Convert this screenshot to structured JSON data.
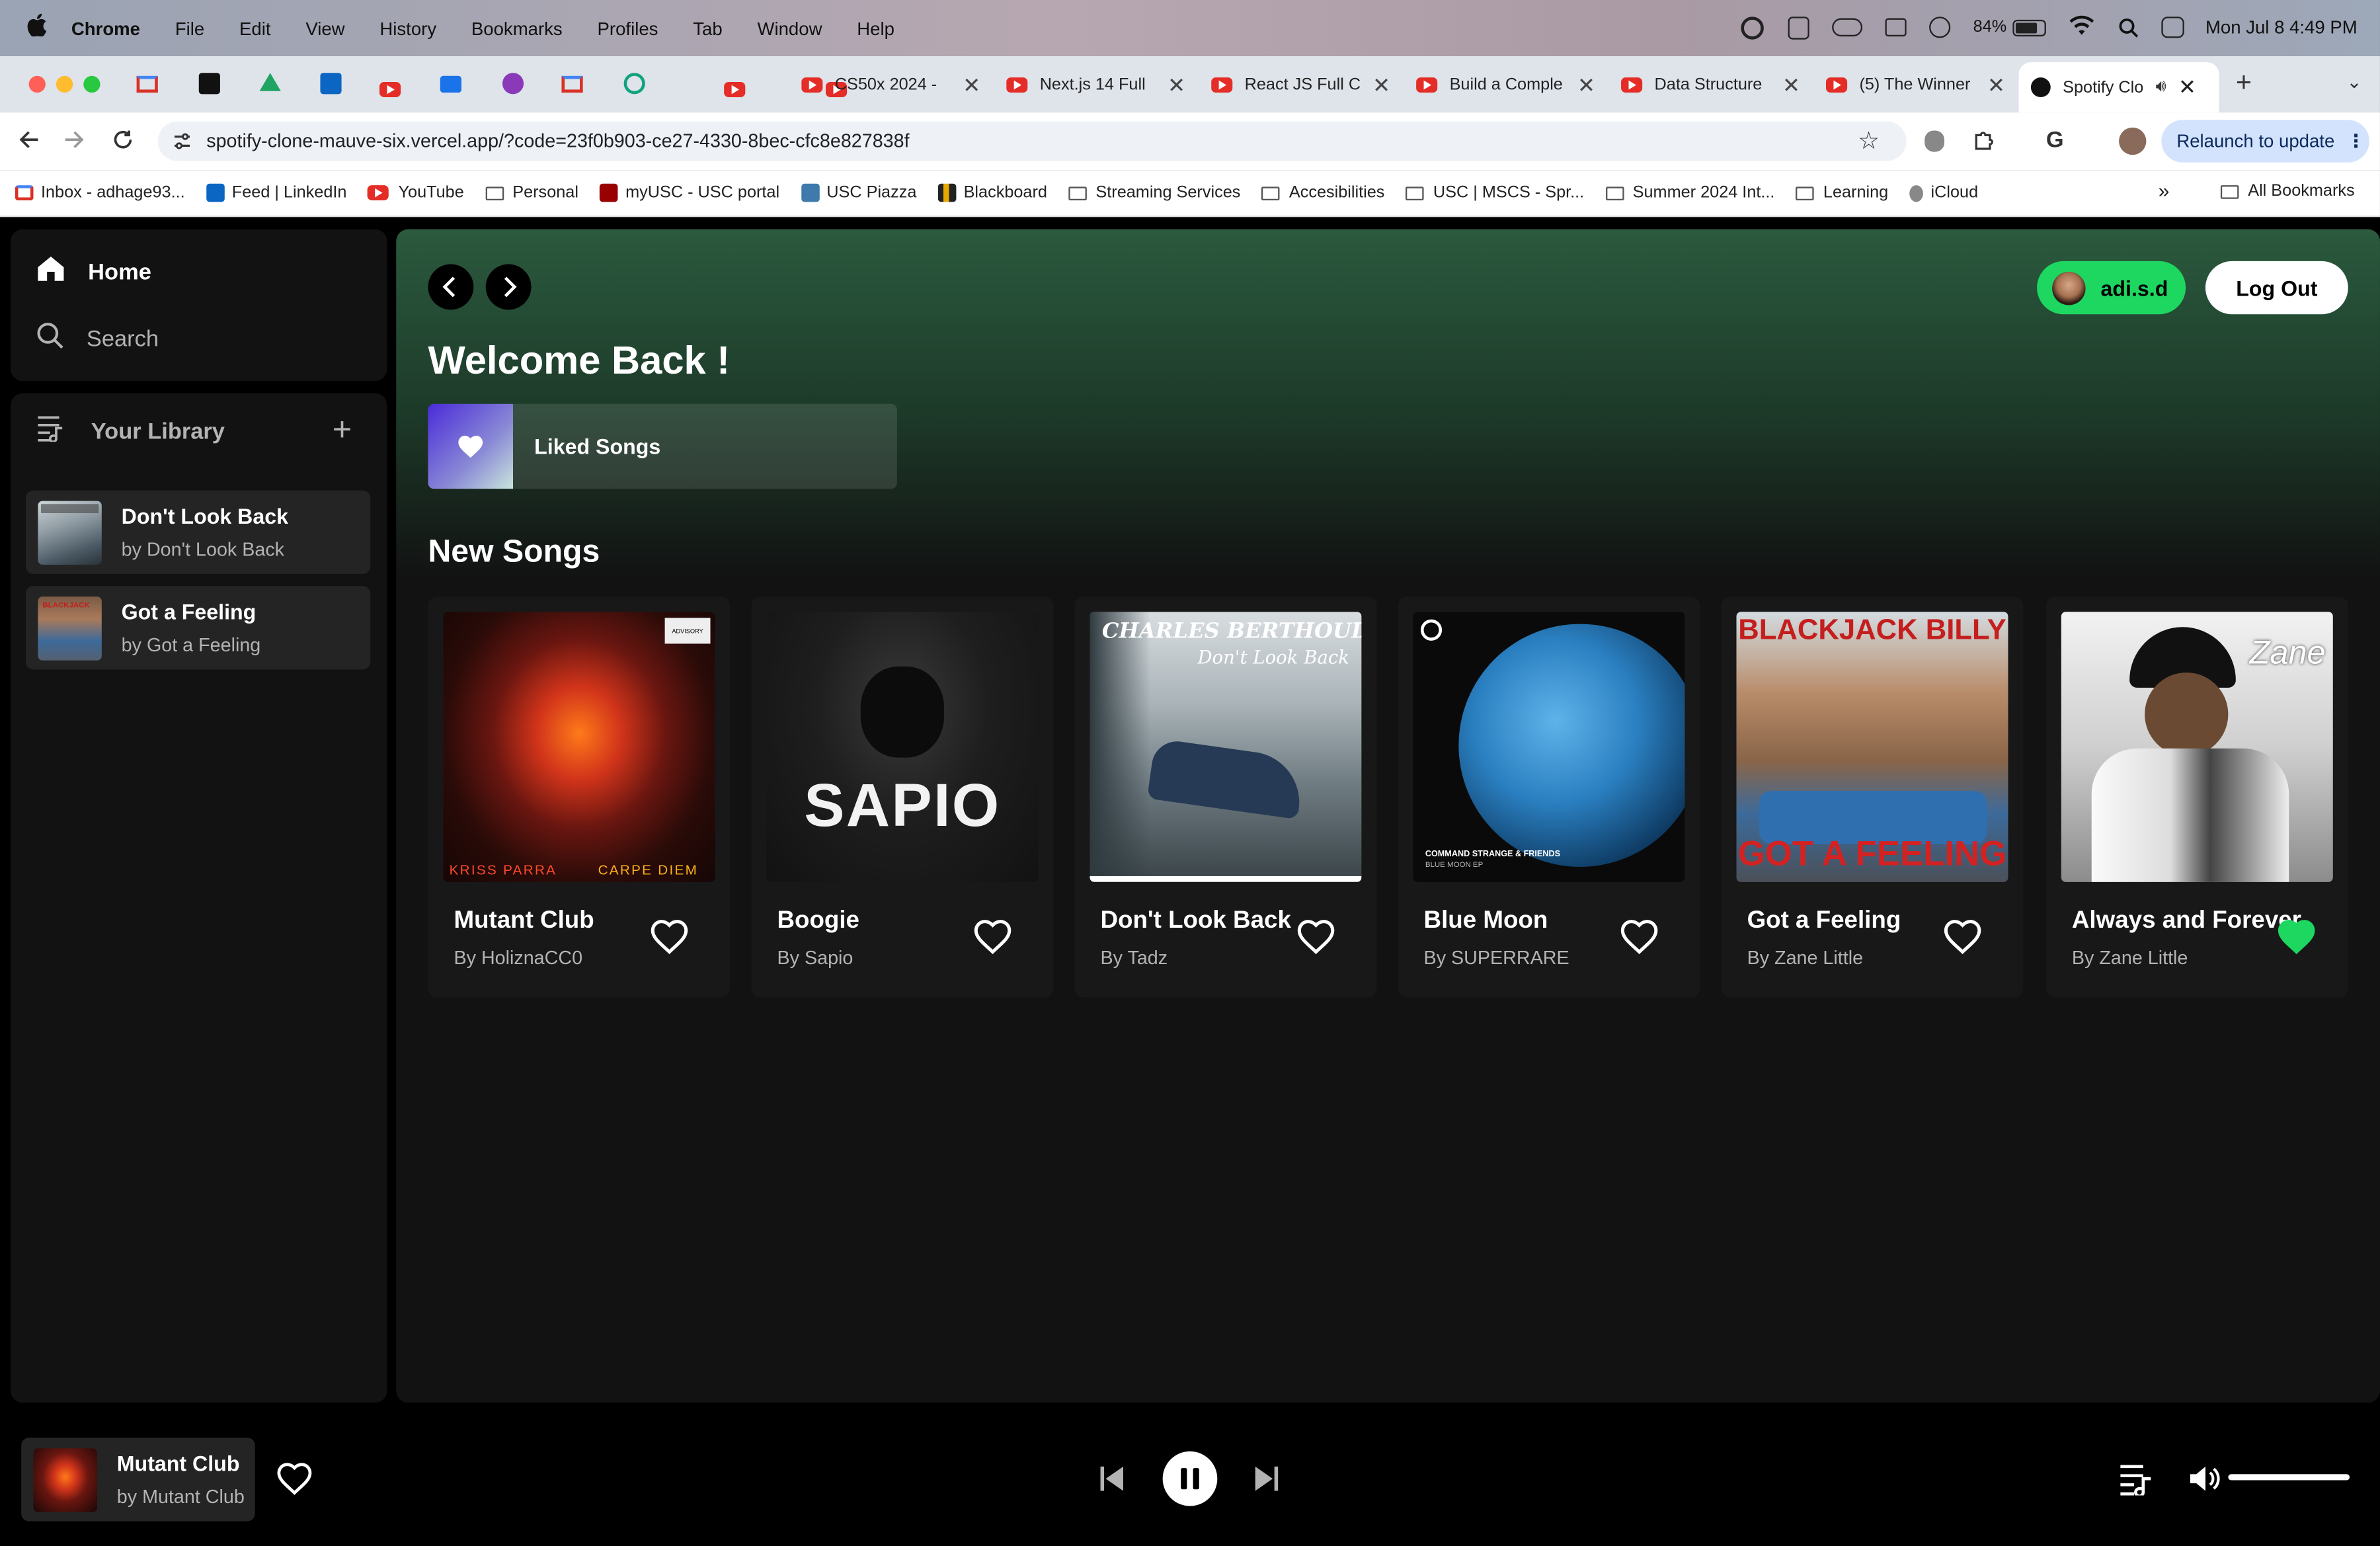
{
  "menubar": {
    "app": "Chrome",
    "items": [
      "File",
      "Edit",
      "View",
      "History",
      "Bookmarks",
      "Profiles",
      "Tab",
      "Window",
      "Help"
    ],
    "battery": "84%",
    "datetime": "Mon Jul 8  4:49 PM"
  },
  "tabs": [
    {
      "label": "CS50x 2024 - "
    },
    {
      "label": "Next.js 14 Full"
    },
    {
      "label": "React JS Full C"
    },
    {
      "label": "Build a Comple"
    },
    {
      "label": "Data Structure"
    },
    {
      "label": "(5) The Winner"
    },
    {
      "label": "Spotify Clo"
    }
  ],
  "address": {
    "url": "spotify-clone-mauve-six.vercel.app/?code=23f0b903-ce27-4330-8bec-cfc8e827838f",
    "relaunch": "Relaunch to update"
  },
  "bookmarks": [
    "Inbox - adhage93...",
    "Feed | LinkedIn",
    "YouTube",
    "Personal",
    "myUSC - USC portal",
    "USC Piazza",
    "Blackboard",
    "Streaming Services",
    "Accesibilities",
    "USC | MSCS - Spr...",
    "Summer 2024 Int...",
    "Learning",
    "iCloud"
  ],
  "all_bookmarks": "All Bookmarks",
  "sidebar": {
    "home": "Home",
    "search": "Search",
    "library": "Your Library",
    "items": [
      {
        "title": "Don't Look Back",
        "sub": "by Don't Look Back"
      },
      {
        "title": "Got a Feeling",
        "sub": "by Got a Feeling"
      }
    ]
  },
  "header": {
    "welcome": "Welcome Back !",
    "user": "adi.s.d",
    "logout": "Log Out",
    "liked": "Liked Songs"
  },
  "new_songs": {
    "heading": "New Songs",
    "cards": [
      {
        "title": "Mutant Club",
        "by": "By HoliznaCC0",
        "liked": false,
        "cover_text": [
          "Kriss Parra",
          "Carpe Diem"
        ]
      },
      {
        "title": "Boogie",
        "by": "By Sapio",
        "liked": false,
        "cover_text": [
          "SAPIO"
        ]
      },
      {
        "title": "Don't Look Back",
        "by": "By Tadz",
        "liked": false,
        "cover_text": [
          "CHARLES BERTHOUD",
          "Don't Look Back"
        ]
      },
      {
        "title": "Blue Moon",
        "by": "By SUPERRARE",
        "liked": false,
        "cover_text": [
          "COMMAND STRANGE & FRIENDS",
          "BLUE MOON EP"
        ]
      },
      {
        "title": "Got a Feeling",
        "by": "By Zane Little",
        "liked": false,
        "cover_text": [
          "BLACKJACK BILLY",
          "GOT A FEELING"
        ]
      },
      {
        "title": "Always and Forever",
        "by": "By Zane Little",
        "liked": true,
        "cover_text": [
          "Zane"
        ]
      }
    ]
  },
  "player": {
    "title": "Mutant Club",
    "artist": "by Mutant Club",
    "volume": 1.0
  },
  "colors": {
    "accent": "#1ed760",
    "header_green": "#2b5a3e",
    "panel": "#121212"
  }
}
